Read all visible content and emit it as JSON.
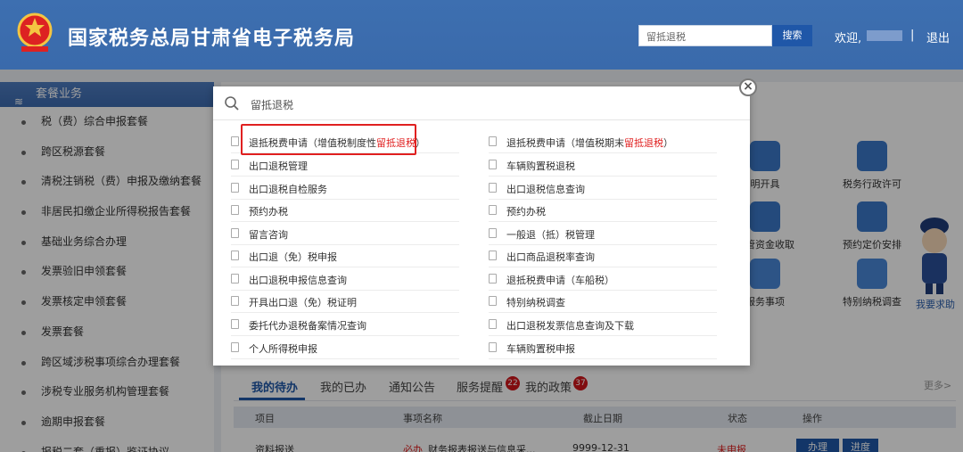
{
  "header": {
    "site_title": "国家税务总局甘肃省电子税务局",
    "search_value": "留抵退税",
    "search_button": "搜索",
    "welcome": "欢迎,",
    "separator": "|",
    "logout": "退出"
  },
  "sidebar": {
    "title": "套餐业务",
    "items": [
      "税（费）综合申报套餐",
      "跨区税源套餐",
      "清税注销税（费）申报及缴纳套餐",
      "非居民扣缴企业所得税报告套餐",
      "基础业务综合办理",
      "发票验旧申领套餐",
      "发票核定申领套餐",
      "发票套餐",
      "跨区域涉税事项综合办理套餐",
      "涉税专业服务机构管理套餐",
      "逾期申报套餐",
      "报税二套（重报）鉴证协议"
    ]
  },
  "tiles": [
    {
      "label": "明开具",
      "color": "#3a78c9"
    },
    {
      "label": "税务行政许可",
      "color": "#3a78c9"
    },
    {
      "label": "保管资金收取",
      "color": "#3a78c9"
    },
    {
      "label": "预约定价安排",
      "color": "#3a78c9"
    },
    {
      "label": "服务事项",
      "color": "#4a88d9"
    },
    {
      "label": "特别纳税调查",
      "color": "#4a88d9"
    }
  ],
  "help": "我要求助",
  "tabs": {
    "todo": "我的待办",
    "done": "我的已办",
    "notice": "通知公告",
    "service": "服务提醒",
    "service_count": "22",
    "policy": "我的政策",
    "policy_count": "37",
    "more": "更多>"
  },
  "table": {
    "headers": [
      "项目",
      "事项名称",
      "截止日期",
      "状态",
      "操作"
    ],
    "row": {
      "project": "资料报送",
      "tag": "必办",
      "name": "财务报表报送与信息采...",
      "date": "9999-12-31",
      "status": "未申报",
      "btn1": "办理",
      "btn2": "进度"
    }
  },
  "popup": {
    "query": "留抵退税",
    "close": "×",
    "left": [
      {
        "pre": "退抵税费申请（增值税制度性",
        "hl": "留抵退税",
        "post": "）"
      },
      {
        "pre": "出口退税管理",
        "hl": "",
        "post": ""
      },
      {
        "pre": "出口退税自检服务",
        "hl": "",
        "post": ""
      },
      {
        "pre": "预约办税",
        "hl": "",
        "post": ""
      },
      {
        "pre": "留言咨询",
        "hl": "",
        "post": ""
      },
      {
        "pre": "出口退（免）税申报",
        "hl": "",
        "post": ""
      },
      {
        "pre": "出口退税申报信息查询",
        "hl": "",
        "post": ""
      },
      {
        "pre": "开具出口退（免）税证明",
        "hl": "",
        "post": ""
      },
      {
        "pre": "委托代办退税备案情况查询",
        "hl": "",
        "post": ""
      },
      {
        "pre": "个人所得税申报",
        "hl": "",
        "post": ""
      }
    ],
    "right": [
      {
        "pre": "退抵税费申请（增值税期末",
        "hl": "留抵退税",
        "post": "）"
      },
      {
        "pre": "车辆购置税退税",
        "hl": "",
        "post": ""
      },
      {
        "pre": "出口退税信息查询",
        "hl": "",
        "post": ""
      },
      {
        "pre": "预约办税",
        "hl": "",
        "post": ""
      },
      {
        "pre": "一般退（抵）税管理",
        "hl": "",
        "post": ""
      },
      {
        "pre": "出口商品退税率查询",
        "hl": "",
        "post": ""
      },
      {
        "pre": "退抵税费申请（车船税）",
        "hl": "",
        "post": ""
      },
      {
        "pre": "特别纳税调查",
        "hl": "",
        "post": ""
      },
      {
        "pre": "出口退税发票信息查询及下载",
        "hl": "",
        "post": ""
      },
      {
        "pre": "车辆购置税申报",
        "hl": "",
        "post": ""
      }
    ]
  }
}
